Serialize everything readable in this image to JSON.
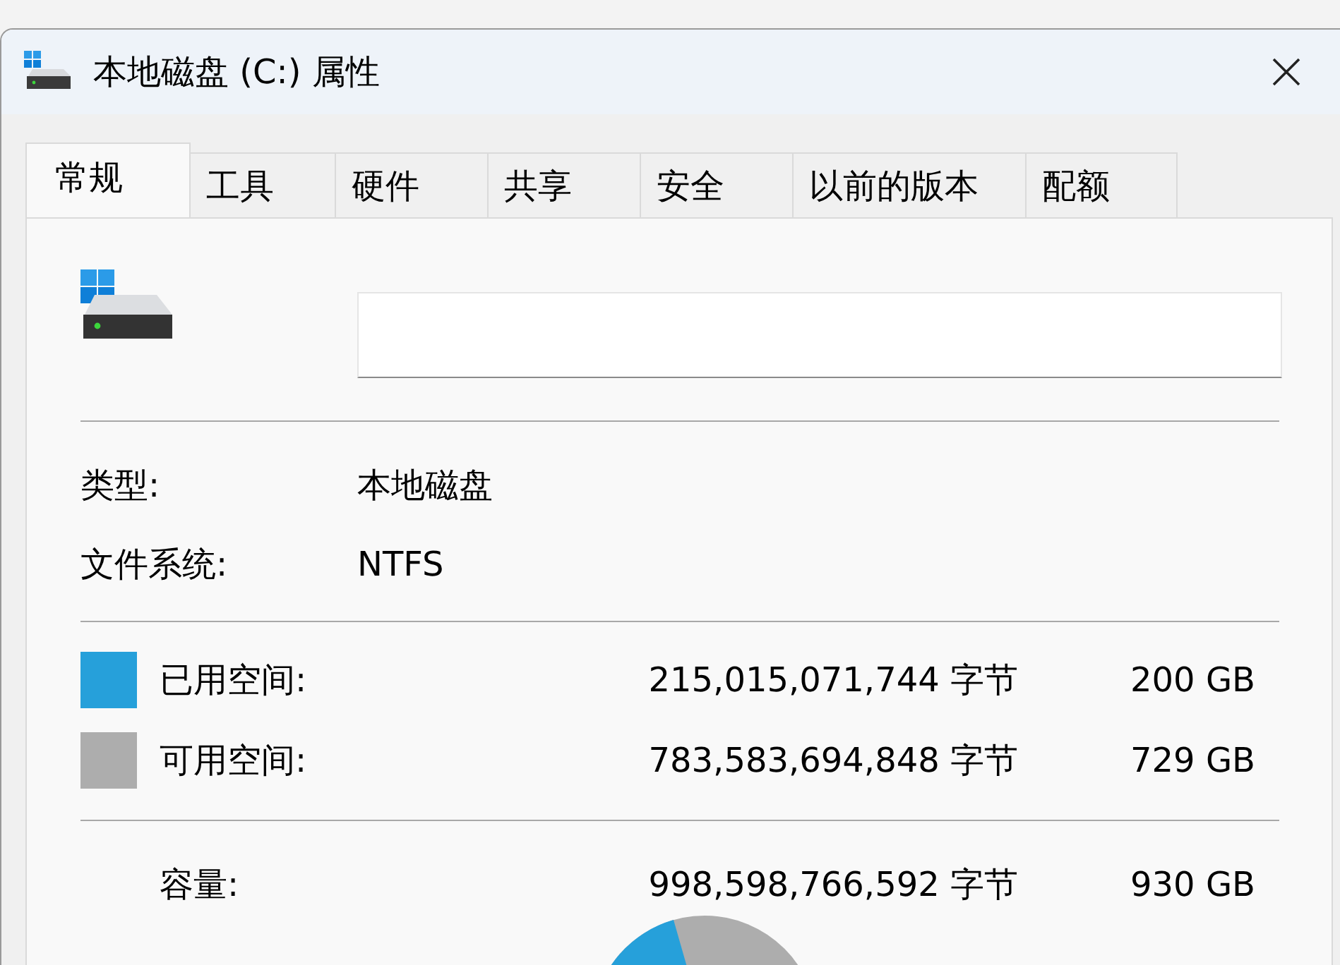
{
  "window": {
    "title": "本地磁盘 (C:) 属性"
  },
  "tabs": [
    {
      "label": "常规",
      "selected": true
    },
    {
      "label": "工具",
      "selected": false
    },
    {
      "label": "硬件",
      "selected": false
    },
    {
      "label": "共享",
      "selected": false
    },
    {
      "label": "安全",
      "selected": false
    },
    {
      "label": "以前的版本",
      "selected": false
    },
    {
      "label": "配额",
      "selected": false
    }
  ],
  "info": [
    {
      "label": "类型:",
      "value": "本地磁盘"
    },
    {
      "label": "文件系统:",
      "value": "NTFS"
    }
  ],
  "space": [
    {
      "label": "已用空间:",
      "bytes": "215,015,071,744 字节",
      "size": "200 GB",
      "color": "#26a0da"
    },
    {
      "label": "可用空间:",
      "bytes": "783,583,694,848 字节",
      "size": "729 GB",
      "color": "#adadad"
    }
  ],
  "capacity": {
    "label": "容量:",
    "bytes": "998,598,766,592 字节",
    "size": "930 GB"
  }
}
